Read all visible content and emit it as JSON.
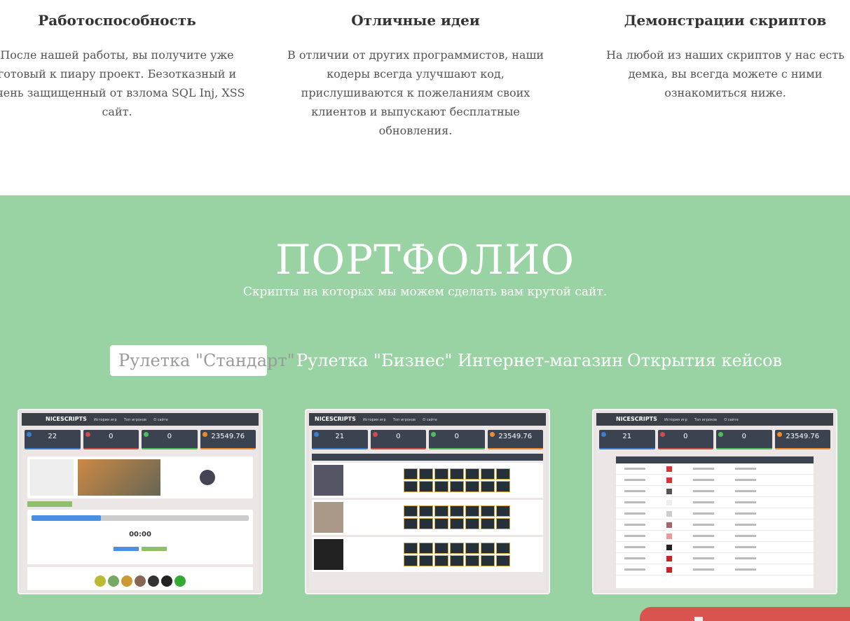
{
  "features": [
    {
      "title": "Работоспособность",
      "text": "После нашей работы, вы получите уже готовый к пиару проект. Безотказный и очень защищенный от взлома SQL Inj, XSS сайт."
    },
    {
      "title": "Отличные идеи",
      "text": "В отличии от других программистов, наши кодеры всегда улучшают код, прислушиваются к пожеланиям своих клиентов и выпускают бесплатные обновления."
    },
    {
      "title": "Демонстрации скриптов",
      "text": "На любой из наших скриптов у нас есть демка, вы всегда можете с ними ознакомиться ниже."
    }
  ],
  "portfolio": {
    "title": "ПОРТФОЛИО",
    "subtitle": "Скрипты на которых мы можем сделать вам крутой сайт.",
    "tabs": [
      {
        "label": "Рулетка \"Стандарт\"",
        "active": true
      },
      {
        "label": "Рулетка \"Бизнес\"",
        "active": false
      },
      {
        "label": "Интернет-магазин",
        "active": false
      },
      {
        "label": "Открытия кейсов",
        "active": false
      }
    ],
    "thumbs": [
      {
        "brand": "NICESCRIPTS",
        "nav": [
          "История игр",
          "Топ игроков",
          "О сайте"
        ],
        "stats": [
          "22",
          "0",
          "0",
          "23549.76"
        ],
        "timer": "00:00"
      },
      {
        "brand": "NICESCRIPTS",
        "nav": [
          "История игр",
          "Топ игроков",
          "О сайте"
        ],
        "stats": [
          "21",
          "0",
          "0",
          "23549.76"
        ]
      },
      {
        "brand": "NICESCRIPTS",
        "nav": [
          "История игр",
          "Топ игроков",
          "О сайте"
        ],
        "stats": [
          "21",
          "0",
          "0",
          "23549.76"
        ]
      }
    ]
  },
  "colors": {
    "section_bg": "#99d3a4",
    "accent_red": "#d9534f"
  }
}
